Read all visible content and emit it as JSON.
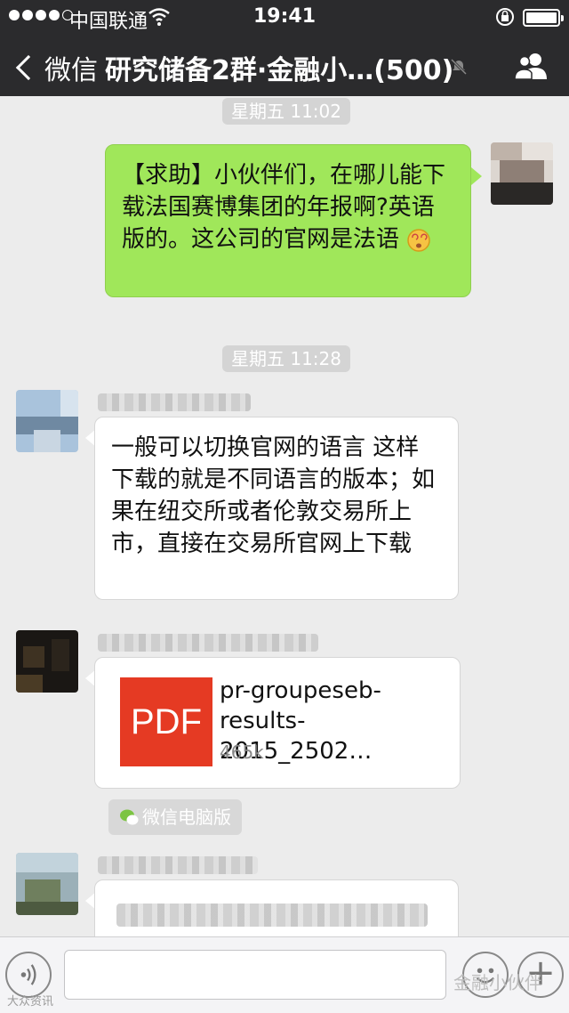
{
  "status_bar": {
    "carrier": "中国联通",
    "time": "19:41"
  },
  "nav": {
    "back_label": "微信",
    "title": "研究储备2群·金融小…(500)"
  },
  "messages": {
    "timestamp_1": "星期五 11:02",
    "my_message": "【求助】小伙伴们，在哪儿能下载法国赛博集团的年报啊?英语版的。这公司的官网是法语",
    "timestamp_2": "星期五 11:28",
    "reply_1": "一般可以切换官网的语言 这样下载的就是不同语言的版本；如果在纽交所或者伦敦交易所上市，直接在交易所官网上下载",
    "file": {
      "icon_label": "PDF",
      "name": "pr-groupeseb-\nresults-2015_2502…",
      "size": "465k"
    },
    "source_tag": "微信电脑版"
  },
  "input_bar": {
    "placeholder": ""
  },
  "watermark": "金融小伙伴",
  "watermark_small": "大众资讯"
}
